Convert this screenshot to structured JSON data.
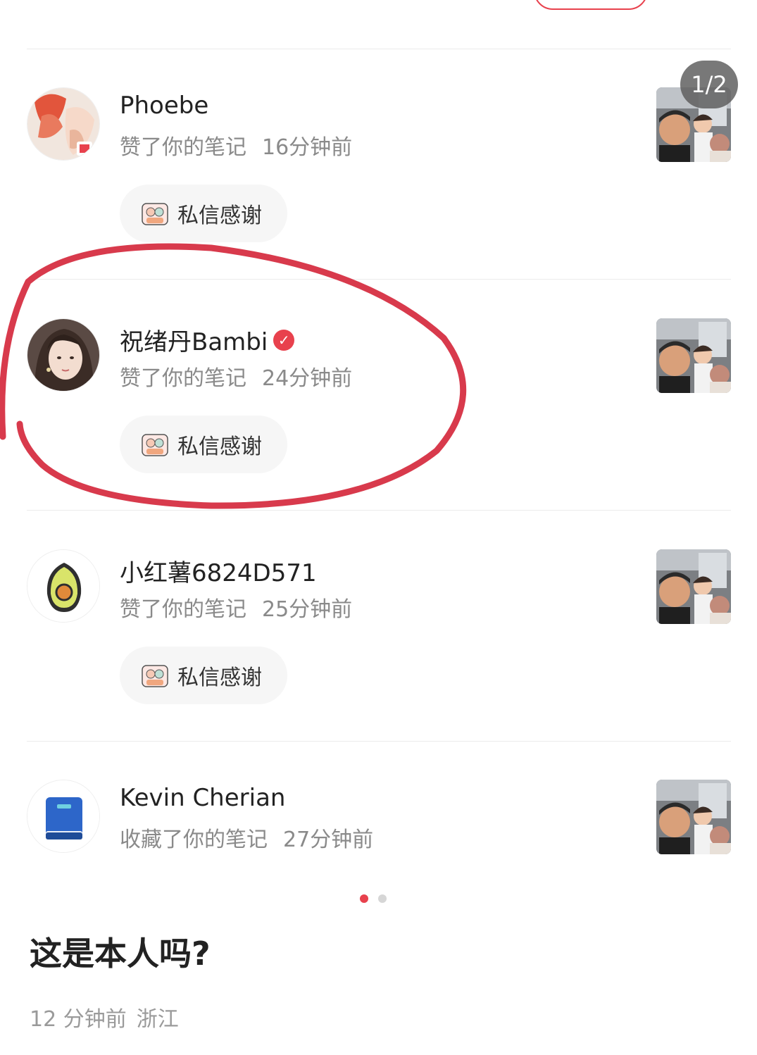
{
  "page_badge": "1/2",
  "thank_label": "私信感谢",
  "notifications": [
    {
      "name": "Phoebe",
      "action": "赞了你的笔记",
      "time": "16分钟前",
      "verified": false,
      "show_thank": true
    },
    {
      "name": "祝绪丹Bambi",
      "action": "赞了你的笔记",
      "time": "24分钟前",
      "verified": true,
      "show_thank": true
    },
    {
      "name": "小红薯6824D571",
      "action": "赞了你的笔记",
      "time": "25分钟前",
      "verified": false,
      "show_thank": true
    },
    {
      "name": "Kevin Cherian",
      "action": "收藏了你的笔记",
      "time": "27分钟前",
      "verified": false,
      "show_thank": false
    }
  ],
  "pagination": {
    "total": 2,
    "active": 1
  },
  "post": {
    "title": "这是本人吗?",
    "time": "12 分钟前",
    "location": "浙江"
  },
  "colors": {
    "accent": "#e8414d",
    "annotation": "#d83a4c"
  }
}
